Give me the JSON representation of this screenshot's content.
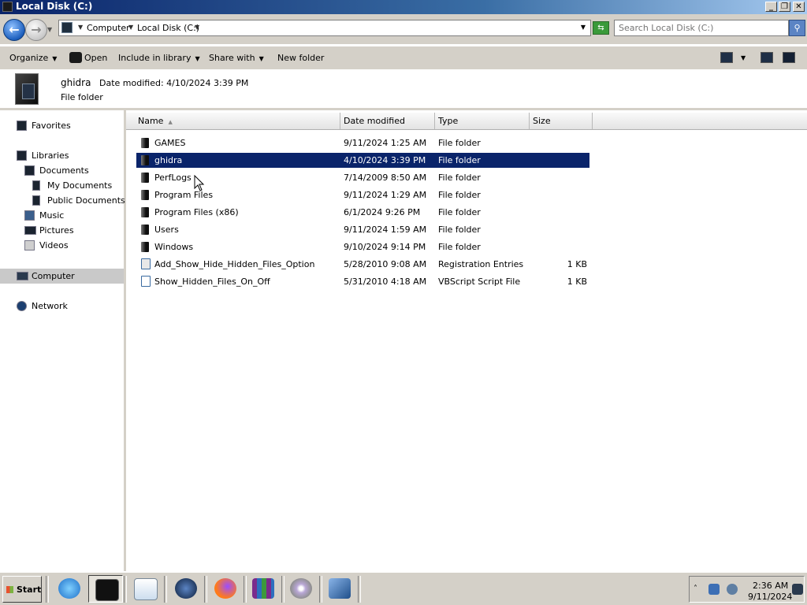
{
  "window": {
    "title": "Local Disk (C:)"
  },
  "address": {
    "crumbs": [
      "Computer",
      "Local Disk (C:)"
    ],
    "search_placeholder": "Search Local Disk (C:)"
  },
  "toolbar": {
    "organize": "Organize",
    "open": "Open",
    "include": "Include in library",
    "share": "Share with",
    "newfolder": "New folder"
  },
  "details": {
    "name": "ghidra",
    "modified": "Date modified: 4/10/2024 3:39 PM",
    "type": "File folder"
  },
  "nav": {
    "favorites": "Favorites",
    "libraries": "Libraries",
    "documents": "Documents",
    "my_documents": "My Documents",
    "public_documents": "Public Documents",
    "music": "Music",
    "pictures": "Pictures",
    "videos": "Videos",
    "computer": "Computer",
    "network": "Network"
  },
  "columns": {
    "name": "Name",
    "date": "Date modified",
    "type": "Type",
    "size": "Size"
  },
  "files": [
    {
      "name": "GAMES",
      "date": "9/11/2024 1:25 AM",
      "type": "File folder",
      "size": "",
      "icon": "folder-icon"
    },
    {
      "name": "ghidra",
      "date": "4/10/2024 3:39 PM",
      "type": "File folder",
      "size": "",
      "icon": "folder-icon",
      "selected": true
    },
    {
      "name": "PerfLogs",
      "date": "7/14/2009 8:50 AM",
      "type": "File folder",
      "size": "",
      "icon": "folder-icon"
    },
    {
      "name": "Program Files",
      "date": "9/11/2024 1:29 AM",
      "type": "File folder",
      "size": "",
      "icon": "folder-icon"
    },
    {
      "name": "Program Files (x86)",
      "date": "6/1/2024 9:26 PM",
      "type": "File folder",
      "size": "",
      "icon": "folder-icon"
    },
    {
      "name": "Users",
      "date": "9/11/2024 1:59 AM",
      "type": "File folder",
      "size": "",
      "icon": "folder-icon"
    },
    {
      "name": "Windows",
      "date": "9/10/2024 9:14 PM",
      "type": "File folder",
      "size": "",
      "icon": "folder-icon"
    },
    {
      "name": "Add_Show_Hide_Hidden_Files_Option",
      "date": "5/28/2010 9:08 AM",
      "type": "Registration Entries",
      "size": "1 KB",
      "icon": "registry-file-icon"
    },
    {
      "name": "Show_Hidden_Files_On_Off",
      "date": "5/31/2010 4:18 AM",
      "type": "VBScript Script File",
      "size": "1 KB",
      "icon": "vbscript-file-icon"
    }
  ],
  "taskbar": {
    "start": "Start",
    "apps": [
      "internet-explorer-icon",
      "explorer-icon",
      "media-player-icon",
      "network-globe-icon",
      "firefox-icon",
      "winrar-icon",
      "disc-burner-icon",
      "virtualbox-icon"
    ],
    "clock_time": "2:36 AM",
    "clock_date": "9/11/2024"
  },
  "colors": {
    "selection": "#0a246a",
    "chrome": "#d4d0c8"
  }
}
